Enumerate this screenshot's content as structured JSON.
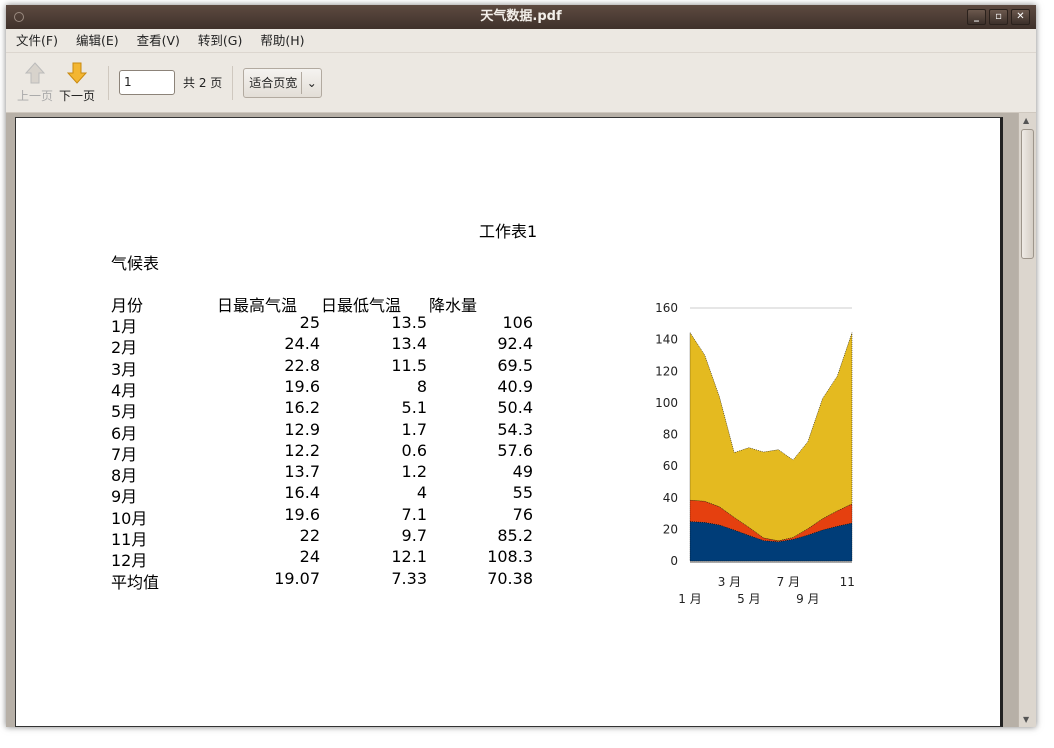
{
  "window": {
    "title": "天气数据.pdf"
  },
  "menu": [
    "文件(F)",
    "编辑(E)",
    "查看(V)",
    "转到(G)",
    "帮助(H)"
  ],
  "toolbar": {
    "prev_label": "上一页",
    "next_label": "下一页",
    "page_value": "1",
    "page_total": "共 2 页",
    "zoom_value": "适合页宽"
  },
  "doc": {
    "sheet_title": "工作表1",
    "table_title": "气候表",
    "headers": [
      "月份",
      "日最高气温",
      "日最低气温",
      "降水量"
    ],
    "rows": [
      [
        "1月",
        "25",
        "13.5",
        "106"
      ],
      [
        "2月",
        "24.4",
        "13.4",
        "92.4"
      ],
      [
        "3月",
        "22.8",
        "11.5",
        "69.5"
      ],
      [
        "4月",
        "19.6",
        "8",
        "40.9"
      ],
      [
        "5月",
        "16.2",
        "5.1",
        "50.4"
      ],
      [
        "6月",
        "12.9",
        "1.7",
        "54.3"
      ],
      [
        "7月",
        "12.2",
        "0.6",
        "57.6"
      ],
      [
        "8月",
        "13.7",
        "1.2",
        "49"
      ],
      [
        "9月",
        "16.4",
        "4",
        "55"
      ],
      [
        "10月",
        "19.6",
        "7.1",
        "76"
      ],
      [
        "11月",
        "22",
        "9.7",
        "85.2"
      ],
      [
        "12月",
        "24",
        "12.1",
        "108.3"
      ],
      [
        "平均值",
        "19.07",
        "7.33",
        "70.38"
      ]
    ]
  },
  "chart_data": {
    "type": "area",
    "stacked": true,
    "categories": [
      "1 月",
      "2 月",
      "3 月",
      "4 月",
      "5 月",
      "6 月",
      "7 月",
      "8 月",
      "9 月",
      "10 月",
      "11",
      "12 月"
    ],
    "x_tick_labels": [
      "1 月",
      "3 月",
      "5 月",
      "7 月",
      "9 月",
      "11"
    ],
    "series": [
      {
        "name": "日最高气温",
        "values": [
          25,
          24.4,
          22.8,
          19.6,
          16.2,
          12.9,
          12.2,
          13.7,
          16.4,
          19.6,
          22,
          24
        ],
        "color": "#003d78"
      },
      {
        "name": "日最低气温",
        "values": [
          13.5,
          13.4,
          11.5,
          8,
          5.1,
          1.7,
          0.6,
          1.2,
          4,
          7.1,
          9.7,
          12.1
        ],
        "color": "#e5400f"
      },
      {
        "name": "降水量",
        "values": [
          106,
          92.4,
          69.5,
          40.9,
          50.4,
          54.3,
          57.6,
          49,
          55,
          76,
          85.2,
          108.3
        ],
        "color": "#e4ba20"
      }
    ],
    "y_ticks": [
      0,
      20,
      40,
      60,
      80,
      100,
      120,
      140,
      160
    ],
    "ylim": [
      0,
      160
    ]
  }
}
